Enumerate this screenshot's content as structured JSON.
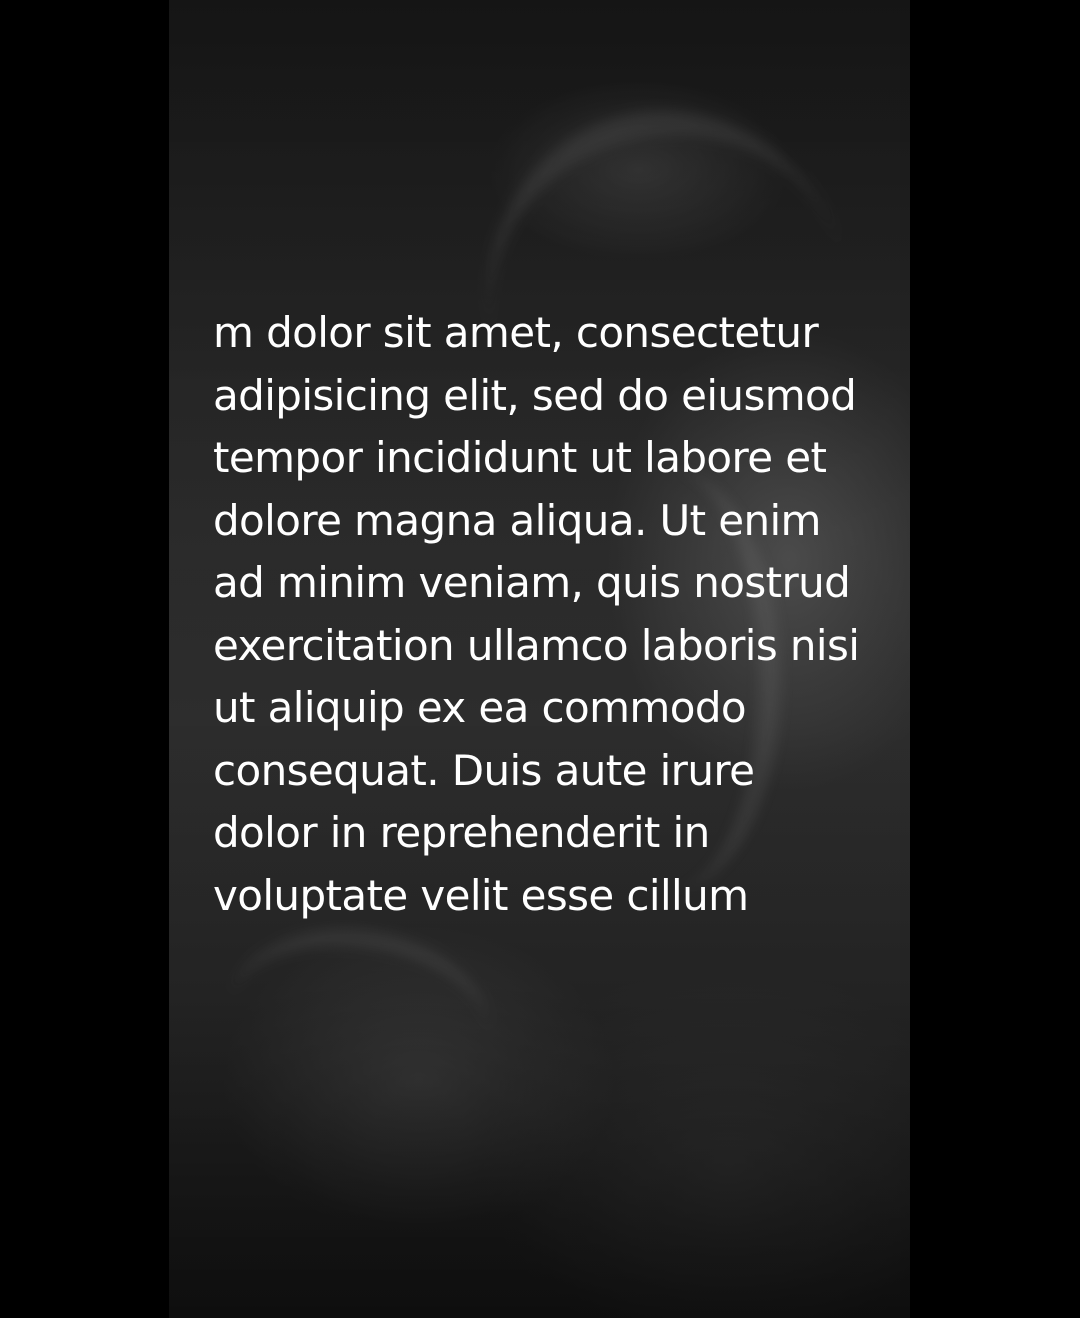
{
  "content": {
    "text": "m dolor sit amet, consectetur\nadipisicing elit, sed do eiusmod\ntempor incididunt ut labore et\ndolore magna aliqua. Ut enim\nad minim veniam, quis nostrud\nexercitation ullamco laboris nisi\nut aliquip ex ea commodo\nconsequat. Duis aute irure\ndolor in reprehenderit in\nvoluptate velit esse cillum"
  },
  "colors": {
    "page_background": "#000000",
    "panel_background": "#2a2a2a",
    "text": "#ffffff"
  }
}
